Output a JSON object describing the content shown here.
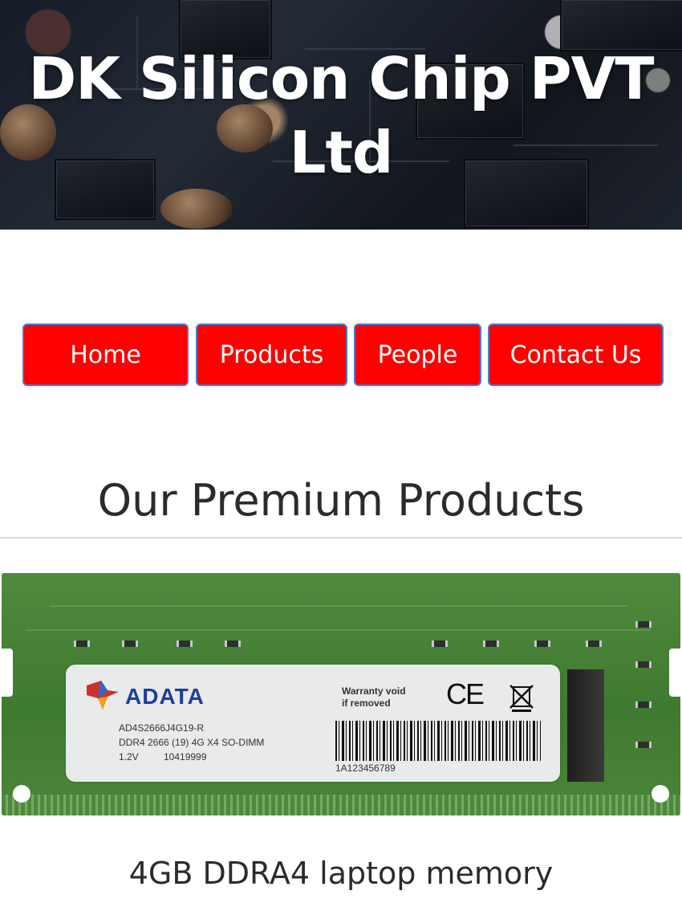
{
  "header": {
    "title": "DK Silicon Chip PVT Ltd",
    "background_image": "circuit-board-photo"
  },
  "nav": {
    "items": [
      {
        "label": "Home"
      },
      {
        "label": "Products"
      },
      {
        "label": "People"
      },
      {
        "label": "Contact Us"
      }
    ],
    "button_color": "#ff0000",
    "border_color": "#4a7ccf"
  },
  "section": {
    "title": "Our Premium Products"
  },
  "product": {
    "image": "ram-module-photo",
    "image_label": {
      "brand": "ADATA",
      "model": "AD4S2666J4G19-R",
      "spec": "DDR4 2666 (19) 4G X4 SO-DIMM",
      "voltage": "1.2V",
      "code": "10419999",
      "warranty_line1": "Warranty void",
      "warranty_line2": "if removed",
      "ce": "CE",
      "barcode_number": "1A123456789"
    },
    "caption": "4GB DDRA4 laptop memory"
  }
}
